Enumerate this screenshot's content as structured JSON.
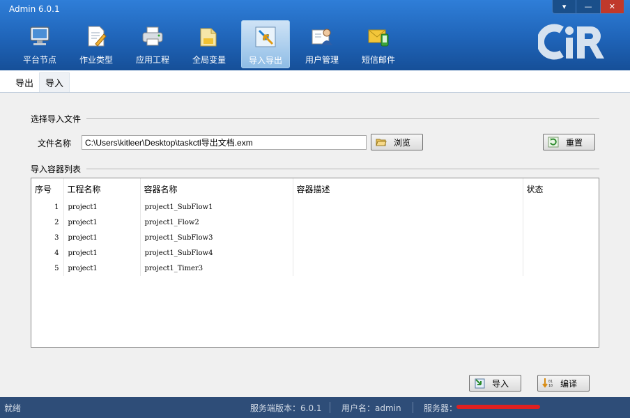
{
  "window": {
    "title": "Admin 6.0.1",
    "minimize": "▾",
    "restore": "—",
    "close": "✕"
  },
  "ribbon": [
    {
      "label": "平台节点",
      "icon": "monitor-icon"
    },
    {
      "label": "作业类型",
      "icon": "document-pencil-icon"
    },
    {
      "label": "应用工程",
      "icon": "printer-icon"
    },
    {
      "label": "全局变量",
      "icon": "folder-file-icon"
    },
    {
      "label": "导入导出",
      "icon": "import-export-arrows-icon",
      "active": true
    },
    {
      "label": "用户管理",
      "icon": "user-card-icon"
    },
    {
      "label": "短信邮件",
      "icon": "mail-phone-icon"
    }
  ],
  "logo": {
    "text": "CiR"
  },
  "subtabs": [
    {
      "label": "导出"
    },
    {
      "label": "导入",
      "active": true
    }
  ],
  "import_file": {
    "group_title": "选择导入文件",
    "file_label": "文件名称",
    "file_value": "C:\\Users\\kitleer\\Desktop\\taskctl导出文档.exm",
    "browse_label": "浏览",
    "reset_label": "重置"
  },
  "container_list": {
    "group_title": "导入容器列表",
    "columns": [
      "序号",
      "工程名称",
      "容器名称",
      "容器描述",
      "状态"
    ],
    "rows": [
      {
        "no": "1",
        "project": "project1",
        "container": "project1_SubFlow1",
        "desc": "",
        "status": ""
      },
      {
        "no": "2",
        "project": "project1",
        "container": "project1_Flow2",
        "desc": "",
        "status": ""
      },
      {
        "no": "3",
        "project": "project1",
        "container": "project1_SubFlow3",
        "desc": "",
        "status": ""
      },
      {
        "no": "4",
        "project": "project1",
        "container": "project1_SubFlow4",
        "desc": "",
        "status": ""
      },
      {
        "no": "5",
        "project": "project1",
        "container": "project1_Timer3",
        "desc": "",
        "status": ""
      }
    ]
  },
  "actions": {
    "import_label": "导入",
    "compile_label": "编译"
  },
  "status_bar": {
    "state": "就绪",
    "server_version": "服务端版本：6.0.1",
    "username": "用户名：admin",
    "server": "服务器："
  },
  "colors": {
    "ribbon_top": "#2f7ed8",
    "ribbon_bottom": "#164f98",
    "status_bg": "#2e4d78",
    "redaction": "#e02020"
  }
}
